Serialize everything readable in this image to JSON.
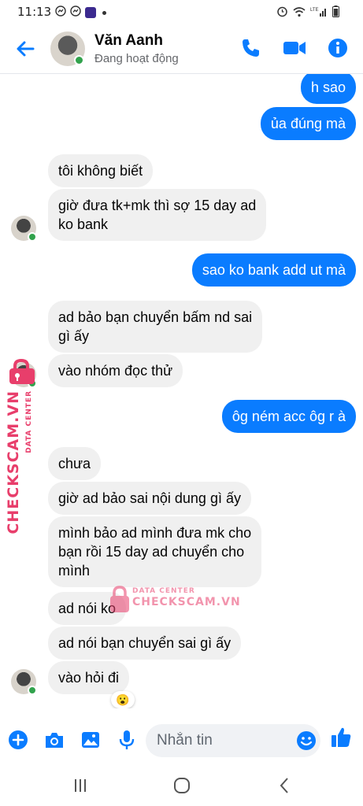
{
  "status_bar": {
    "time": "11:13"
  },
  "header": {
    "contact_name": "Văn Aanh",
    "contact_status": "Đang hoạt động"
  },
  "messages": [
    {
      "dir": "out",
      "text": "h sao"
    },
    {
      "dir": "out",
      "text": "ủa đúng mà"
    },
    {
      "dir": "in",
      "text": "tôi không biết"
    },
    {
      "dir": "in",
      "text": "giờ đưa tk+mk thì sợ 15 day ad\nko bank"
    },
    {
      "dir": "out",
      "text": "sao ko bank add ut mà"
    },
    {
      "dir": "in",
      "text": "ad bảo bạn chuyển bấm nd sai\ngì ấy"
    },
    {
      "dir": "in",
      "text": "vào nhóm đọc thử"
    },
    {
      "dir": "out",
      "text": "ôg ném acc ôg r à"
    },
    {
      "dir": "in",
      "text": "chưa"
    },
    {
      "dir": "in",
      "text": "giờ ad bảo sai nội dung gì ấy"
    },
    {
      "dir": "in",
      "text": "mình bảo ad mình đưa mk cho\nbạn rồi 15 day ad chuyển cho\nmình"
    },
    {
      "dir": "in",
      "text": "ad nói ko"
    },
    {
      "dir": "in",
      "text": "ad nói bạn chuyển sai gì ấy"
    },
    {
      "dir": "in",
      "text": "vào hỏi đi"
    }
  ],
  "reaction": {
    "emoji": "😮"
  },
  "watermark": {
    "side_text": "CHECKSCAM.VN",
    "side_sub": "DATA CENTER",
    "center_sub": "DATA CENTER",
    "center_text": "CHECKSCAM.VN"
  },
  "composer": {
    "placeholder": "Nhắn tin"
  },
  "colors": {
    "accent": "#0a7cff",
    "incoming_bubble": "#f0f0f0",
    "online": "#31a24c",
    "watermark": "#e83e6b"
  },
  "icons": {
    "header": [
      "back-arrow-icon",
      "phone-icon",
      "video-camera-icon",
      "info-icon"
    ],
    "composer": [
      "plus-circle-icon",
      "camera-icon",
      "image-icon",
      "microphone-icon",
      "emoji-icon",
      "thumbs-up-icon"
    ],
    "navbar": [
      "recent-apps-icon",
      "home-icon",
      "back-icon"
    ]
  }
}
